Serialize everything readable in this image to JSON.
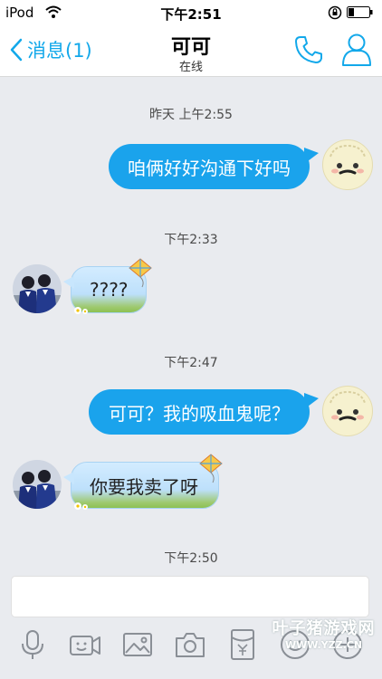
{
  "status_bar": {
    "carrier": "iPod",
    "time": "下午2:51"
  },
  "nav": {
    "back_label": "消息(1)",
    "title": "可可",
    "subtitle": "在线"
  },
  "messages": [
    {
      "timestamp": "昨天 上午2:55",
      "from": "me",
      "text": "咱俩好好沟通下好吗"
    },
    {
      "timestamp": "下午2:33",
      "from": "her",
      "text": "????"
    },
    {
      "timestamp": "下午2:47",
      "from": "me",
      "text": "可可？我的吸血鬼呢？"
    },
    {
      "timestamp": "",
      "from": "her",
      "text": "你要我卖了呀"
    },
    {
      "timestamp": "下午2:50",
      "from": "",
      "text": ""
    }
  ],
  "input": {
    "value": "",
    "placeholder": ""
  },
  "toolbar": [
    "mic-icon",
    "video-icon",
    "image-icon",
    "camera-icon",
    "red-packet-icon",
    "emoji-icon",
    "plus-icon"
  ],
  "watermark": {
    "line1": "叶子猪游戏网",
    "line2": "WWW.YZZ.CN"
  },
  "colors": {
    "accent": "#12a8ea",
    "outgoing_bubble": "#1aa3ec",
    "background": "#e9ebef"
  }
}
